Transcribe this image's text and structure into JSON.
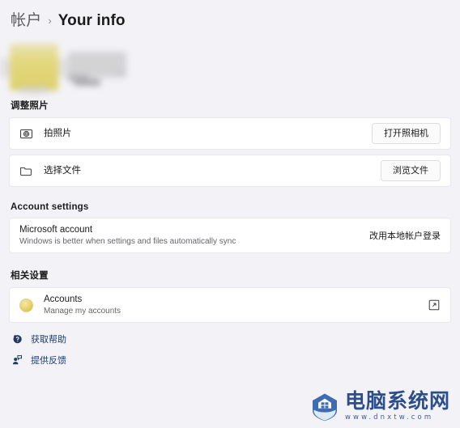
{
  "breadcrumb": {
    "parent": "帐户",
    "separator": "›",
    "current": "Your info"
  },
  "profile": {
    "redacted": true
  },
  "sections": {
    "adjust_photo": {
      "heading": "调整照片",
      "rows": [
        {
          "icon": "camera-icon",
          "title": "拍照片",
          "button": "打开照相机"
        },
        {
          "icon": "folder-icon",
          "title": "选择文件",
          "button": "浏览文件"
        }
      ]
    },
    "account_settings": {
      "heading": "Account settings",
      "rows": [
        {
          "title": "Microsoft account",
          "subtitle": "Windows is better when settings and files automatically sync",
          "link": "改用本地帐户登录"
        }
      ]
    },
    "related_settings": {
      "heading": "相关设置",
      "rows": [
        {
          "icon": "accounts-avatar-icon",
          "title": "Accounts",
          "subtitle": "Manage my accounts",
          "trailing_icon": "external-link-icon"
        }
      ]
    }
  },
  "footer": {
    "links": [
      {
        "icon": "help-icon",
        "label": "获取帮助"
      },
      {
        "icon": "feedback-icon",
        "label": "提供反馈"
      }
    ]
  },
  "watermark": {
    "title": "电脑系统网",
    "url": "www.dnxtw.com"
  },
  "colors": {
    "page_background": "#f3f3f7",
    "card_background": "#ffffff",
    "card_border": "#e8e8ec",
    "link_text": "#1d3c73",
    "watermark_blue": "#2c4f8c",
    "avatar_gold": "#e9d06a"
  }
}
